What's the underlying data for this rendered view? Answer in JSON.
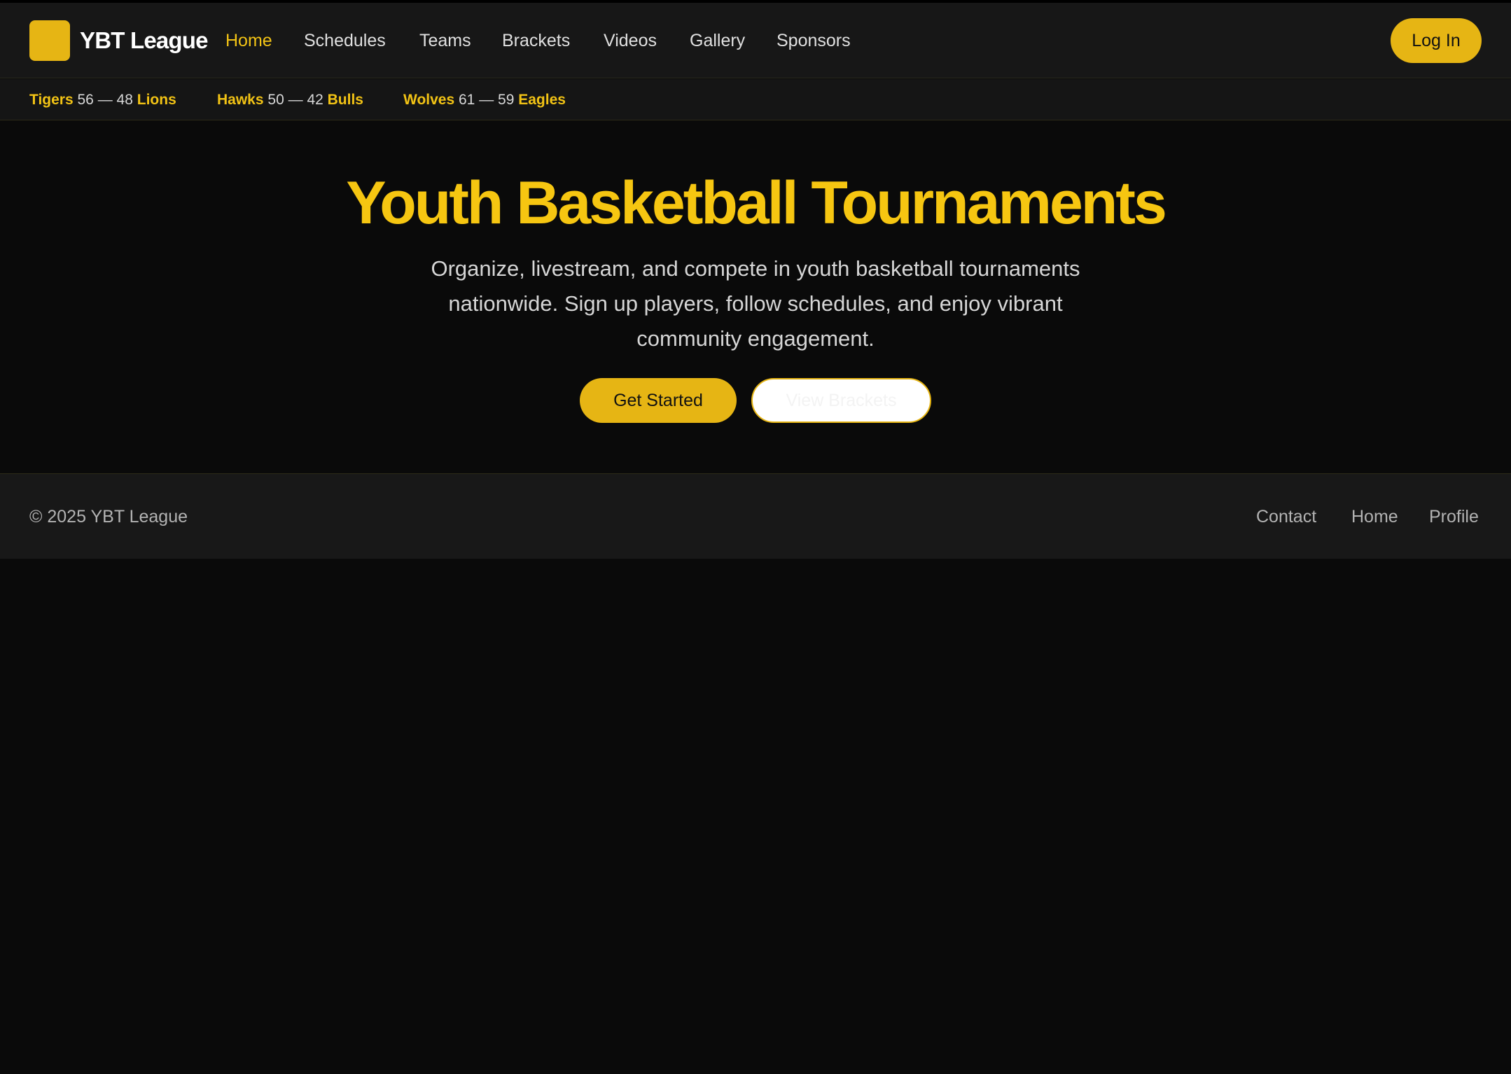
{
  "brand": {
    "name": "YBT League"
  },
  "nav": {
    "items": [
      {
        "label": "Home",
        "active": true
      },
      {
        "label": "Schedules",
        "active": false
      },
      {
        "label": "Teams",
        "active": false
      },
      {
        "label": "Brackets",
        "active": false
      },
      {
        "label": "Videos",
        "active": false
      },
      {
        "label": "Gallery",
        "active": false
      },
      {
        "label": "Sponsors",
        "active": false
      }
    ],
    "login_label": "Log In"
  },
  "ticker": {
    "games": [
      {
        "home": "Tigers",
        "home_score": "56",
        "separator": "—",
        "away_score": "48",
        "away": "Lions"
      },
      {
        "home": "Hawks",
        "home_score": "50",
        "separator": "—",
        "away_score": "42",
        "away": "Bulls"
      },
      {
        "home": "Wolves",
        "home_score": "61",
        "separator": "—",
        "away_score": "59",
        "away": "Eagles"
      }
    ]
  },
  "hero": {
    "title": "Youth Basketball Tournaments",
    "subtitle": "Organize, livestream, and compete in youth basketball tournaments nationwide. Sign up players, follow schedules, and enjoy vibrant community engagement.",
    "primary_cta": "Get Started",
    "secondary_cta": "View Brackets"
  },
  "footer": {
    "copyright": "© 2025 YBT League",
    "links": [
      "Contact",
      "Home",
      "Profile"
    ]
  },
  "colors": {
    "accent": "#e6b514",
    "title_yellow": "#f6c611",
    "background": "#0a0a0a",
    "header_bg": "#171717"
  }
}
